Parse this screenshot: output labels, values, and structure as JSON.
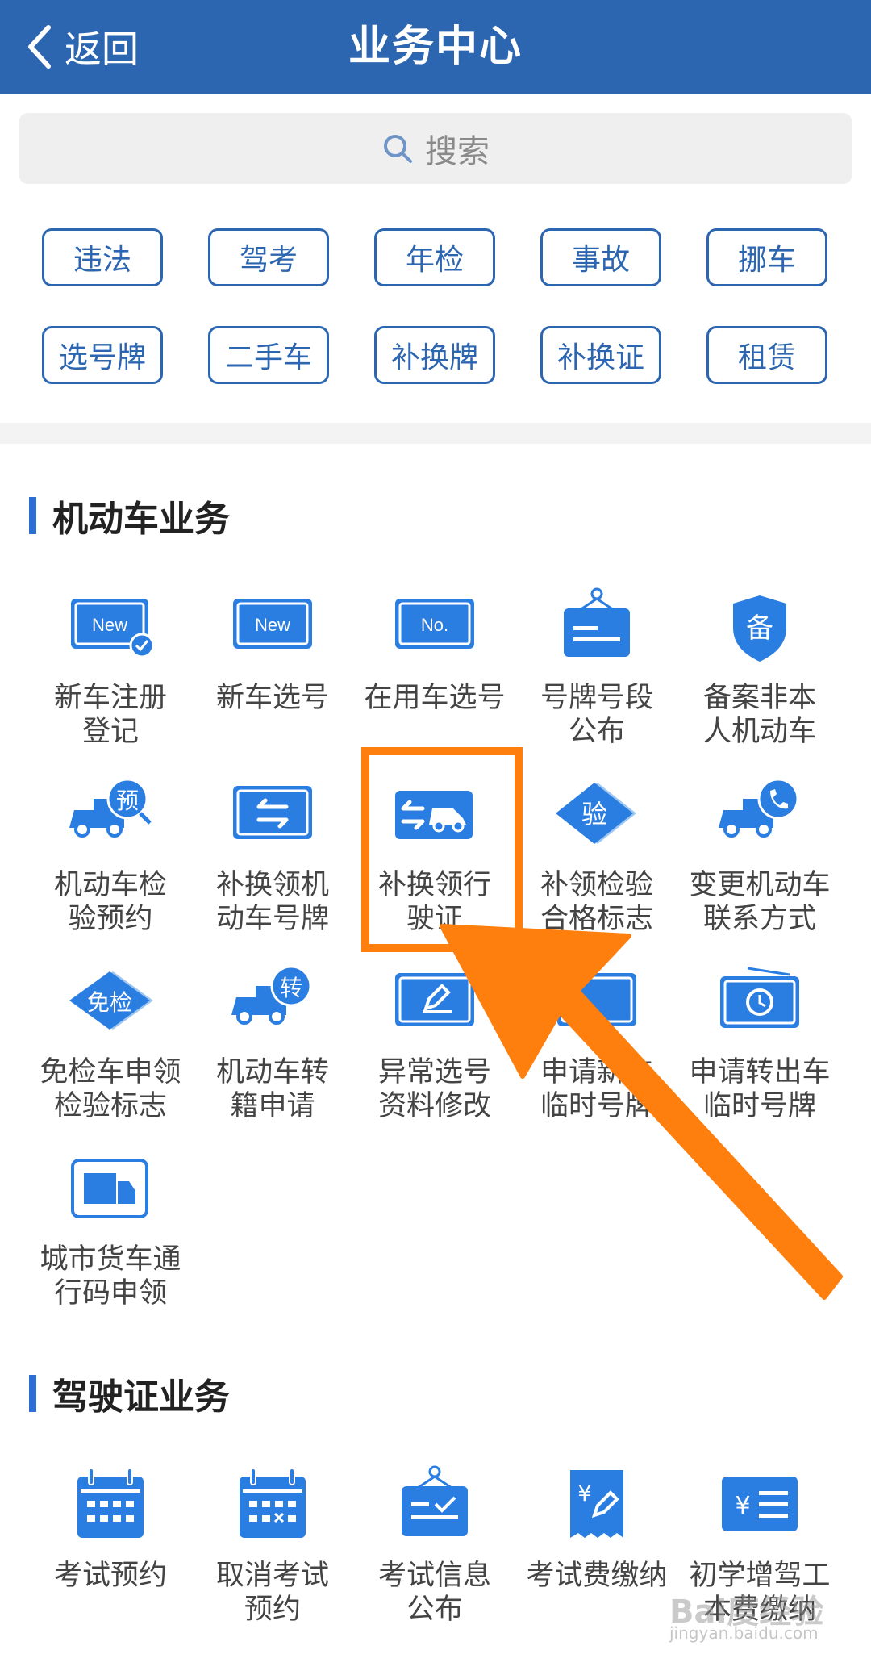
{
  "header": {
    "back_label": "返回",
    "title": "业务中心"
  },
  "search": {
    "placeholder": "搜索"
  },
  "quick_tags": [
    "违法",
    "驾考",
    "年检",
    "事故",
    "挪车",
    "选号牌",
    "二手车",
    "补换牌",
    "补换证",
    "租赁"
  ],
  "section1": {
    "title": "机动车业务",
    "items": [
      {
        "label": "新车注册\n登记",
        "icon": "new-plate-check-icon"
      },
      {
        "label": "新车选号",
        "icon": "new-plate-icon"
      },
      {
        "label": "在用车选号",
        "icon": "plate-no-icon"
      },
      {
        "label": "号牌号段\n公布",
        "icon": "sign-board-icon"
      },
      {
        "label": "备案非本\n人机动车",
        "icon": "shield-record-icon"
      },
      {
        "label": "机动车检\n验预约",
        "icon": "truck-reserve-icon"
      },
      {
        "label": "补换领机\n动车号牌",
        "icon": "plate-swap-icon"
      },
      {
        "label": "补换领行\n驶证",
        "icon": "car-swap-icon"
      },
      {
        "label": "补领检验\n合格标志",
        "icon": "inspect-diamond-icon"
      },
      {
        "label": "变更机动车\n联系方式",
        "icon": "truck-phone-icon"
      },
      {
        "label": "免检车申领\n检验标志",
        "icon": "exempt-diamond-icon"
      },
      {
        "label": "机动车转\n籍申请",
        "icon": "truck-transfer-icon"
      },
      {
        "label": "异常选号\n资料修改",
        "icon": "plate-edit-icon"
      },
      {
        "label": "申请新车\n临时号牌",
        "icon": "temp-plate-icon"
      },
      {
        "label": "申请转出车\n临时号牌",
        "icon": "plate-clock-icon"
      },
      {
        "label": "城市货车通\n行码申领",
        "icon": "cargo-truck-icon"
      }
    ]
  },
  "section2": {
    "title": "驾驶证业务",
    "items": [
      {
        "label": "考试预约",
        "icon": "calendar-icon"
      },
      {
        "label": "取消考试\n预约",
        "icon": "calendar-cancel-icon"
      },
      {
        "label": "考试信息\n公布",
        "icon": "notice-board-icon"
      },
      {
        "label": "考试费缴纳",
        "icon": "fee-receipt-icon"
      },
      {
        "label": "初学增驾工\n本费缴纳",
        "icon": "yen-list-icon"
      }
    ]
  },
  "watermark": {
    "text": "Bai度经验",
    "sub": "jingyan.baidu.com"
  },
  "colors": {
    "header": "#2d66b0",
    "tag_border": "#2d66b0",
    "icon_blue": "#2a7de1",
    "highlight": "#ff7f0e"
  }
}
